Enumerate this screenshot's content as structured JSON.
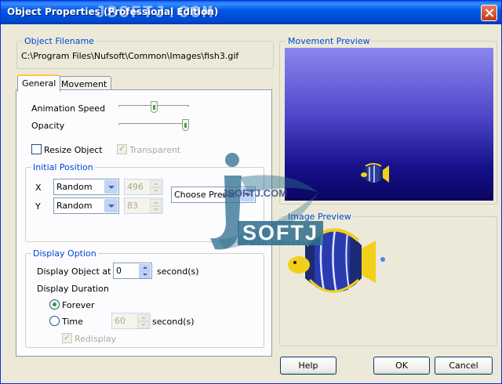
{
  "window": {
    "title": "Object Properties (Professional Edition)"
  },
  "watermark": {
    "top_text": "JSOFTJ.COM",
    "mid_text": "JSOFTJ.COM",
    "brand": "SOFTJ",
    "small": "WWW.JSOFTJ.COM"
  },
  "filename": {
    "label": "Object Filename",
    "path": "C:\\Program Files\\Nufsoft\\Common\\Images\\fish3.gif"
  },
  "tabs": [
    {
      "label": "General"
    },
    {
      "label": "Movement"
    }
  ],
  "general": {
    "animation_speed_label": "Animation Speed",
    "animation_speed_value": 0.5,
    "opacity_label": "Opacity",
    "opacity_value": 1.0,
    "resize_label": "Resize Object",
    "resize_checked": false,
    "transparent_label": "Transparent",
    "transparent_checked": true
  },
  "initial_position": {
    "label": "Initial Position",
    "x_label": "X",
    "x_mode": "Random",
    "x_value": "496",
    "y_label": "Y",
    "y_mode": "Random",
    "y_value": "83",
    "preset_label": "Choose Preset"
  },
  "display_option": {
    "label": "Display Option",
    "display_at_label": "Display Object at",
    "display_at_value": "0",
    "seconds_label": "second(s)",
    "duration_label": "Display Duration",
    "forever_label": "Forever",
    "forever_selected": true,
    "time_label": "Time",
    "time_value": "60",
    "time_seconds_label": "second(s)",
    "redisplay_label": "Redisplay",
    "redisplay_checked": true
  },
  "movement_preview": {
    "label": "Movement Preview"
  },
  "image_preview": {
    "label": "Image Preview"
  },
  "buttons": {
    "help": "Help",
    "ok": "OK",
    "cancel": "Cancel"
  },
  "colors": {
    "group_label": "#0046D5",
    "titlebar": "#0058E6",
    "preview_top": "#8A86F0",
    "preview_bottom": "#0A0560"
  }
}
